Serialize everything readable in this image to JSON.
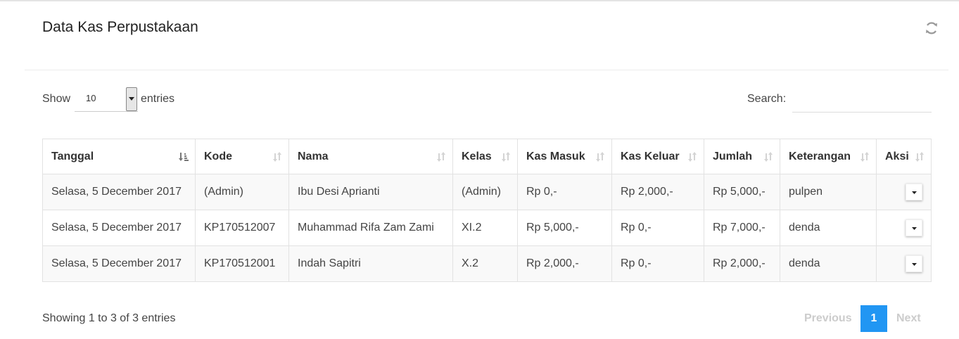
{
  "header": {
    "title": "Data Kas Perpustakaan",
    "refresh_icon": "refresh-icon"
  },
  "controls": {
    "show_label": "Show",
    "entries_value": "10",
    "entries_label": "entries",
    "search_label": "Search:",
    "search_value": ""
  },
  "table": {
    "columns": [
      "Tanggal",
      "Kode",
      "Nama",
      "Kelas",
      "Kas Masuk",
      "Kas Keluar",
      "Jumlah",
      "Keterangan",
      "Aksi"
    ],
    "sorted_column": "Tanggal",
    "rows": [
      [
        "Selasa, 5 December 2017",
        "(Admin)",
        "Ibu Desi Aprianti",
        "(Admin)",
        "Rp 0,-",
        "Rp 2,000,-",
        "Rp 5,000,-",
        "pulpen"
      ],
      [
        "Selasa, 5 December 2017",
        "KP170512007",
        "Muhammad Rifa Zam Zami",
        "XI.2",
        "Rp 5,000,-",
        "Rp 0,-",
        "Rp 7,000,-",
        "denda"
      ],
      [
        "Selasa, 5 December 2017",
        "KP170512001",
        "Indah Sapitri",
        "X.2",
        "Rp 2,000,-",
        "Rp 0,-",
        "Rp 2,000,-",
        "denda"
      ]
    ]
  },
  "footer": {
    "info": "Showing 1 to 3 of 3 entries",
    "previous": "Previous",
    "current_page": "1",
    "next": "Next"
  },
  "colors": {
    "accent": "#2196f3",
    "disabled": "#cccccc"
  }
}
